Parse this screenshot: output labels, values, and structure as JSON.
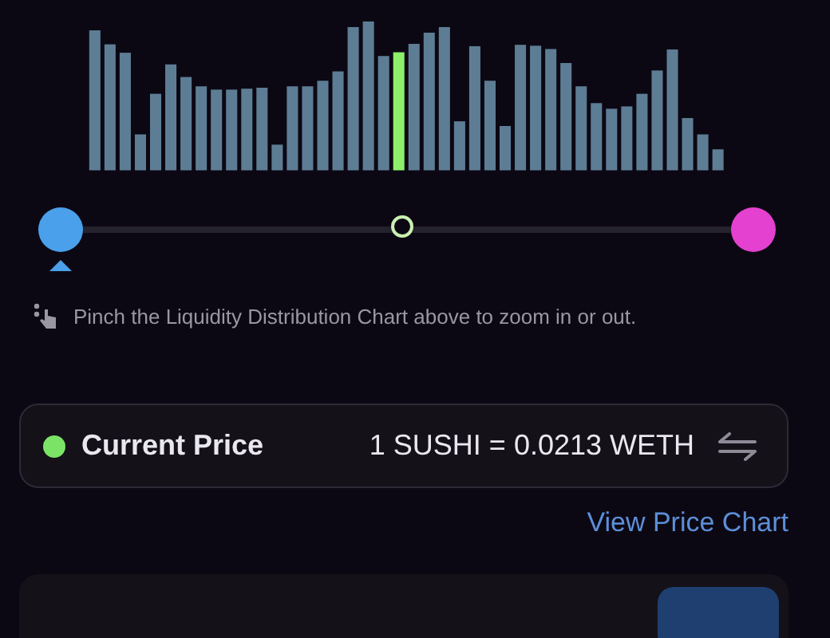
{
  "range_slider": {
    "thumbs": [
      {
        "level": 0.0
      },
      {
        "level": 1.0
      }
    ],
    "marker": {
      "level": 0.495
    }
  },
  "hint": "Pinch the Liquidity Distribution Chart above to zoom in or out.",
  "current_price": {
    "label": "Current Price",
    "value": "1 SUSHI = 0.0213 WETH"
  },
  "link": "View Price Chart"
}
